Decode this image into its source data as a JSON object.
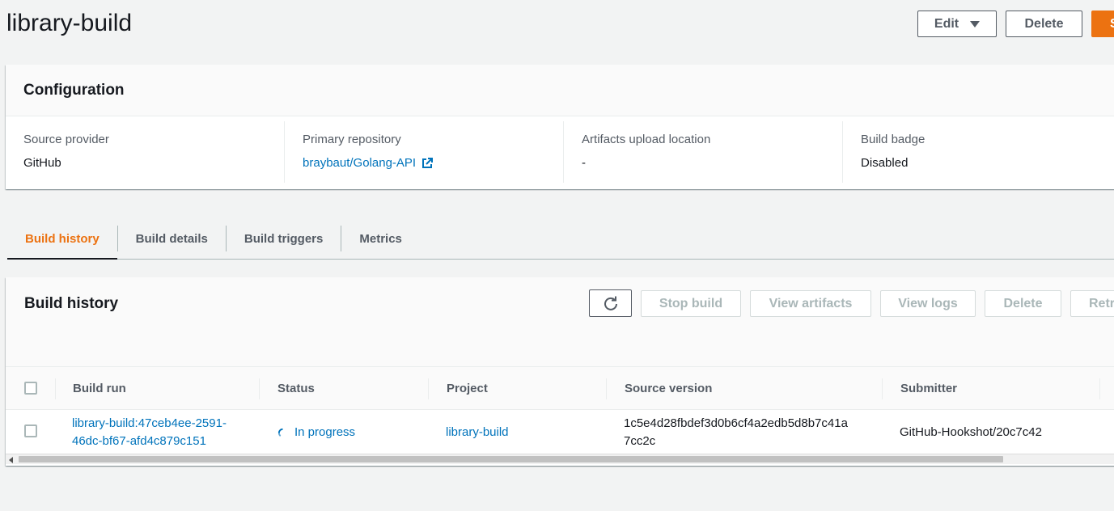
{
  "header": {
    "title": "library-build",
    "edit_label": "Edit",
    "delete_label": "Delete",
    "start_label": "S"
  },
  "configuration": {
    "title": "Configuration",
    "fields": [
      {
        "label": "Source provider",
        "value": "GitHub"
      },
      {
        "label": "Primary repository",
        "value": "braybaut/Golang-API"
      },
      {
        "label": "Artifacts upload location",
        "value": "-"
      },
      {
        "label": "Build badge",
        "value": "Disabled"
      }
    ]
  },
  "tabs": [
    {
      "label": "Build history",
      "active": true
    },
    {
      "label": "Build details",
      "active": false
    },
    {
      "label": "Build triggers",
      "active": false
    },
    {
      "label": "Metrics",
      "active": false
    }
  ],
  "build_history": {
    "title": "Build history",
    "actions": {
      "stop": "Stop build",
      "artifacts": "View artifacts",
      "logs": "View logs",
      "delete": "Delete",
      "retry": "Retr"
    },
    "columns": [
      "Build run",
      "Status",
      "Project",
      "Source version",
      "Submitter"
    ],
    "rows": [
      {
        "build_run_line1": "library-build:47ceb4ee-2591-",
        "build_run_line2": "46dc-bf67-afd4c879c151",
        "status": "In progress",
        "project": "library-build",
        "source_version_line1": "1c5e4d28fbdef3d0b6cf4a2edb5d8b7c41a",
        "source_version_line2": "7cc2c",
        "submitter": "GitHub-Hookshot/20c7c42"
      }
    ]
  },
  "colors": {
    "accent": "#ec7211",
    "link": "#0073bb",
    "text": "#16191f",
    "muted": "#545b64",
    "disabled": "#aab7b8"
  }
}
